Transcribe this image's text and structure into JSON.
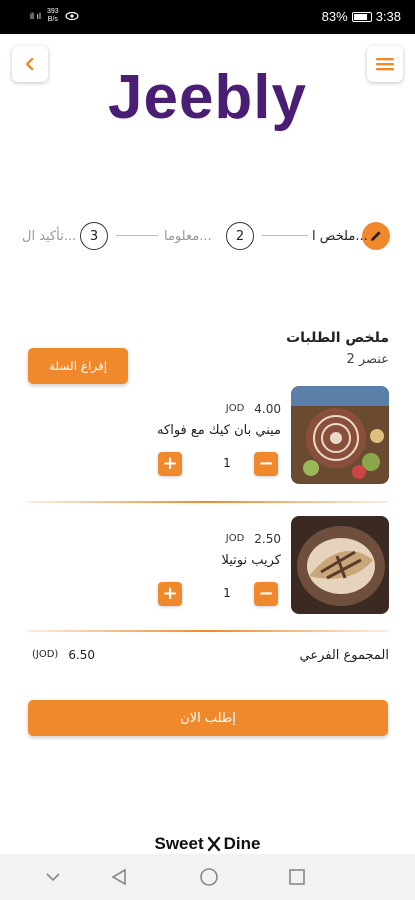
{
  "status_bar": {
    "signal": "il ıl",
    "speed_value": "393",
    "speed_unit": "B/s",
    "battery": "83%",
    "battery_level": 0.83,
    "time": "3:38"
  },
  "header": {
    "logo": "Jeebly",
    "back_icon": "chevron-left-icon",
    "menu_icon": "hamburger-menu-icon"
  },
  "stepper": {
    "steps": [
      {
        "number": "",
        "label": "ملخص ا...",
        "icon": "pencil-icon",
        "active": true
      },
      {
        "number": "2",
        "label": "معلوما...",
        "active": false
      },
      {
        "number": "3",
        "label": "تأكيد ال...",
        "active": false
      }
    ]
  },
  "summary": {
    "title": "ملخص الطلبات",
    "count": "2 عنصر",
    "empty_cart_label": "إفراغ السلة"
  },
  "items": [
    {
      "price": "4.00",
      "currency": "JOD",
      "name": "ميني بان كيك مع فواكه",
      "quantity": "1",
      "minus": "−",
      "plus": "+"
    },
    {
      "price": "2.50",
      "currency": "JOD",
      "name": "كريب نوتيلا",
      "quantity": "1",
      "minus": "−",
      "plus": "+"
    }
  ],
  "subtotal": {
    "label": "المجموع الفرعي",
    "value": "6.50",
    "currency": "(JOD)"
  },
  "order_button": "إطلب الان",
  "brand": {
    "left": "Sweet",
    "right": "Dine"
  },
  "colors": {
    "accent": "#f0892c",
    "logo": "#4a1e72"
  }
}
